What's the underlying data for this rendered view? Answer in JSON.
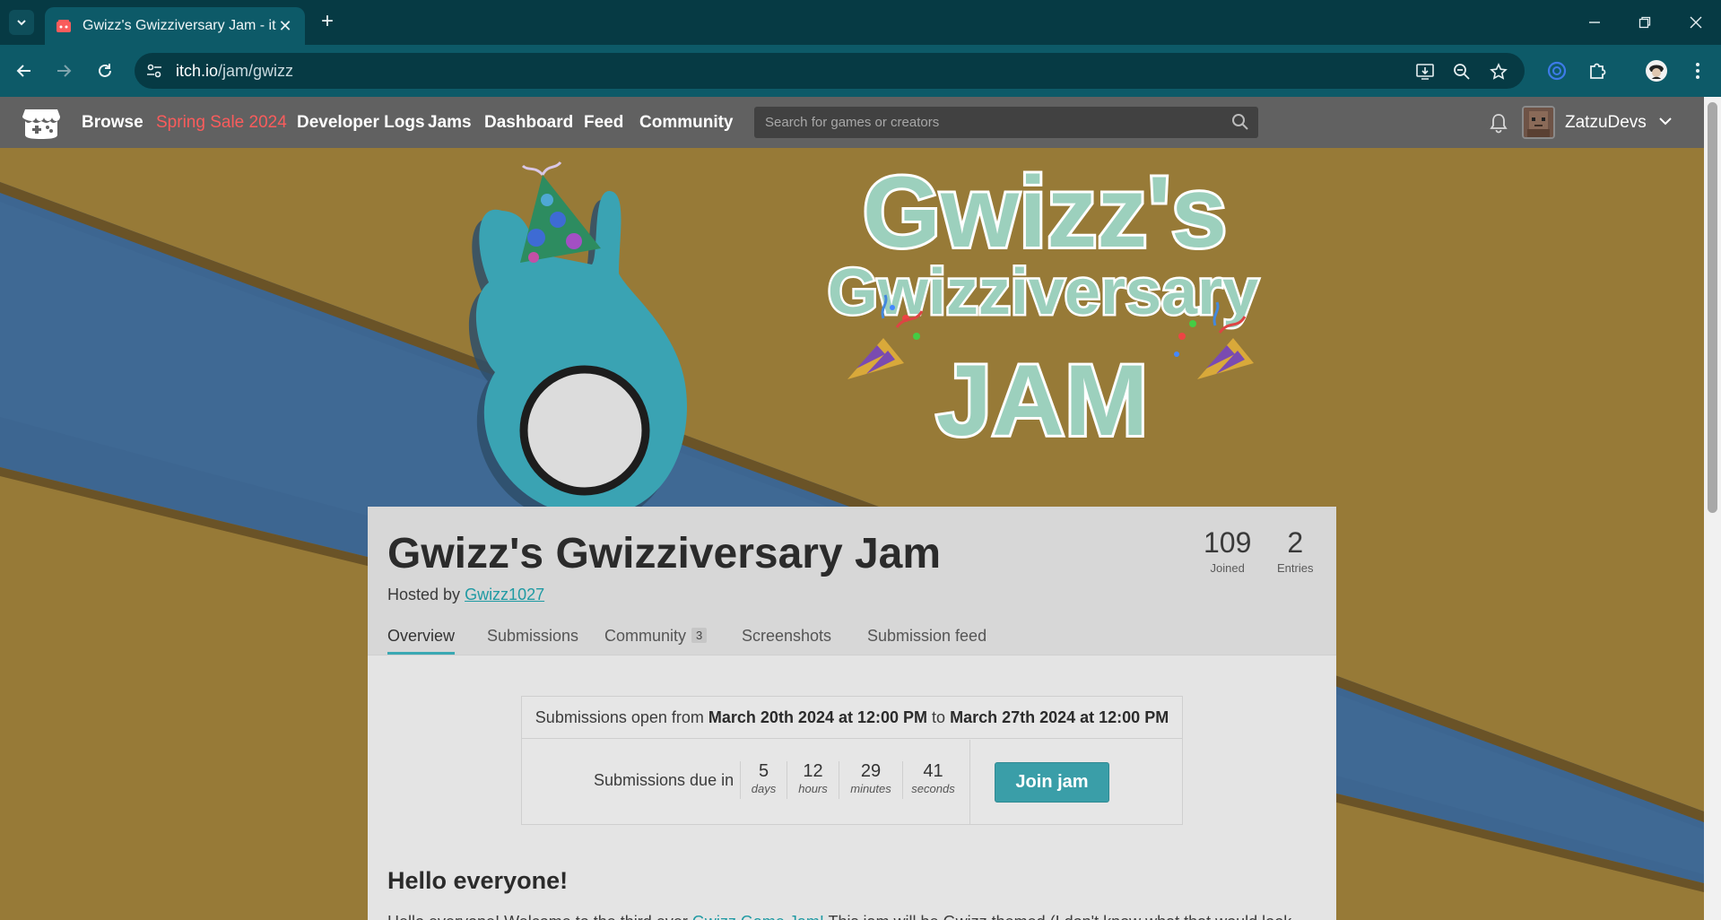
{
  "browser": {
    "tab_title": "Gwizz's Gwizziversary Jam - itch.io",
    "url_host": "itch.io",
    "url_path": "/jam/gwizz"
  },
  "itch": {
    "nav": [
      "Browse",
      "Spring Sale 2024",
      "Developer Logs",
      "Jams",
      "Dashboard",
      "Feed",
      "Community"
    ],
    "search_placeholder": "Search for games or creators",
    "username": "ZatzuDevs"
  },
  "banner": {
    "line1": "Gwizz's",
    "line2": "Gwizziversary",
    "line3": "JAM",
    "colors": {
      "bg": "#977a37",
      "stripe": "#3f6994",
      "teal": "#3aa3b3",
      "text": "#9cd0bd"
    }
  },
  "jam": {
    "title": "Gwizz's Gwizziversary Jam",
    "hosted_by_label": "Hosted by",
    "host": "Gwizz1027",
    "stats": [
      {
        "value": "109",
        "label": "Joined"
      },
      {
        "value": "2",
        "label": "Entries"
      }
    ],
    "tabs": [
      "Overview",
      "Submissions",
      "Community",
      "Screenshots",
      "Submission feed"
    ],
    "community_badge": "3",
    "dates": {
      "prefix": "Submissions open from",
      "start": "March 20th 2024 at 12:00 PM",
      "mid": "to",
      "end": "March 27th 2024 at 12:00 PM"
    },
    "due_label": "Submissions due in",
    "countdown": [
      {
        "value": "5",
        "unit": "days"
      },
      {
        "value": "12",
        "unit": "hours"
      },
      {
        "value": "29",
        "unit": "minutes"
      },
      {
        "value": "41",
        "unit": "seconds"
      }
    ],
    "join_button": "Join jam",
    "heading": "Hello everyone!",
    "paragraph_start": "Hello everyone! Welcome to the third ever ",
    "paragraph_link": "Gwizz Game Jam!",
    "paragraph_end": " This jam will be Gwizz themed (I don't know what that would look"
  }
}
